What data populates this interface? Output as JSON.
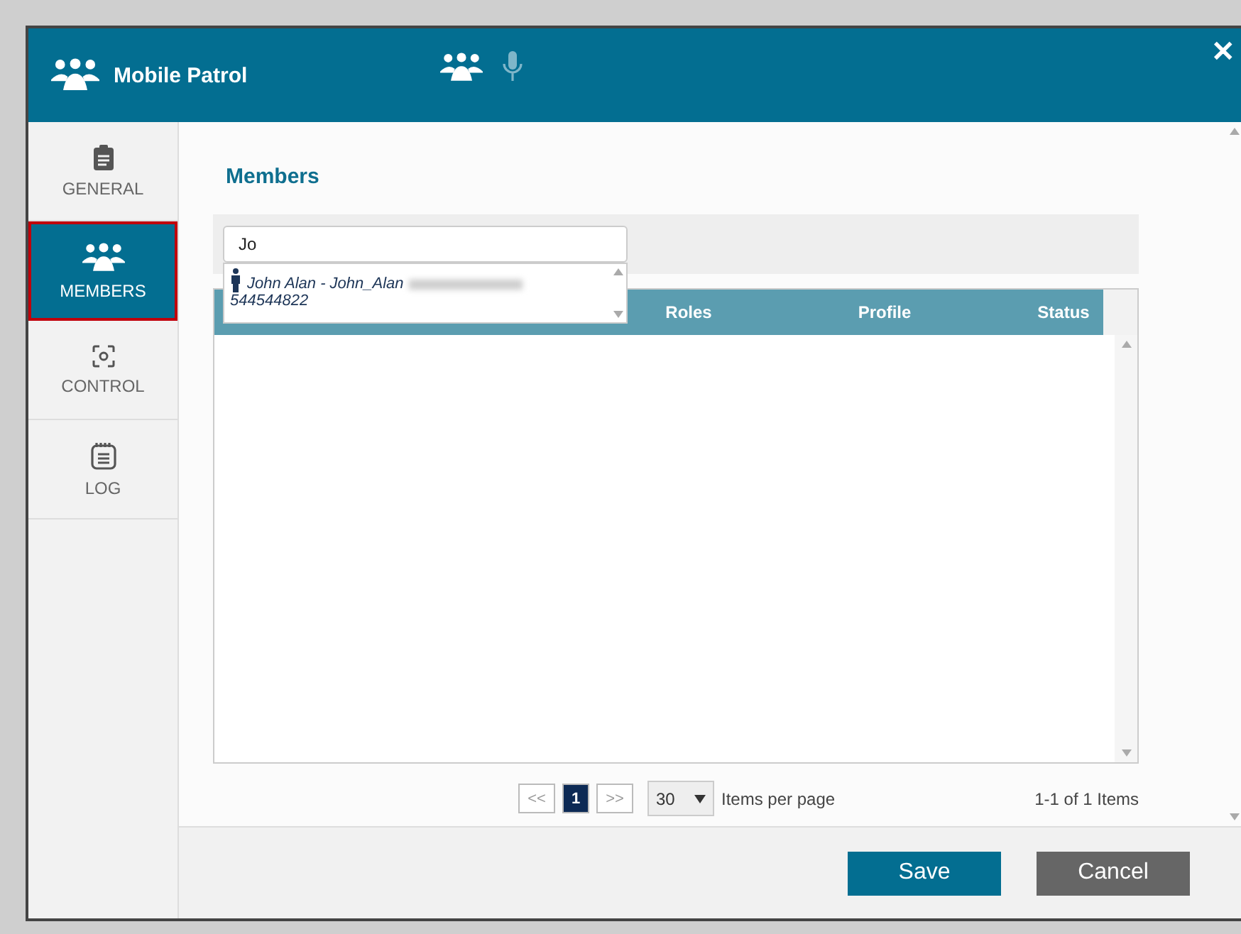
{
  "window": {
    "title": "Mobile Patrol",
    "close": "✕"
  },
  "header_tabs": [
    {
      "kind": "members",
      "selected": true
    },
    {
      "kind": "mic",
      "selected": false
    }
  ],
  "sidebar": {
    "items": [
      {
        "kind": "general",
        "label": "GENERAL",
        "selected": false
      },
      {
        "kind": "members",
        "label": "MEMBERS",
        "selected": true
      },
      {
        "kind": "control",
        "label": "CONTROL",
        "selected": false
      },
      {
        "kind": "log",
        "label": "LOG",
        "selected": false
      }
    ]
  },
  "section_title": "Members",
  "search": {
    "value": "Jo"
  },
  "suggestions": [
    {
      "name": "John Alan -  John_Alan",
      "phone": "544544822"
    }
  ],
  "table": {
    "columns": [
      "Roles",
      "Profile",
      "Status"
    ]
  },
  "pagination": {
    "prev": "<<",
    "pages": [
      {
        "label": "1",
        "selected": true
      }
    ],
    "next": ">>",
    "page_size": "30",
    "page_size_label": "Items per page",
    "summary": "1-1 of 1 Items"
  },
  "buttons": [
    {
      "kind": "primary",
      "label": "Save"
    },
    {
      "kind": "secondary",
      "label": "Cancel"
    }
  ]
}
